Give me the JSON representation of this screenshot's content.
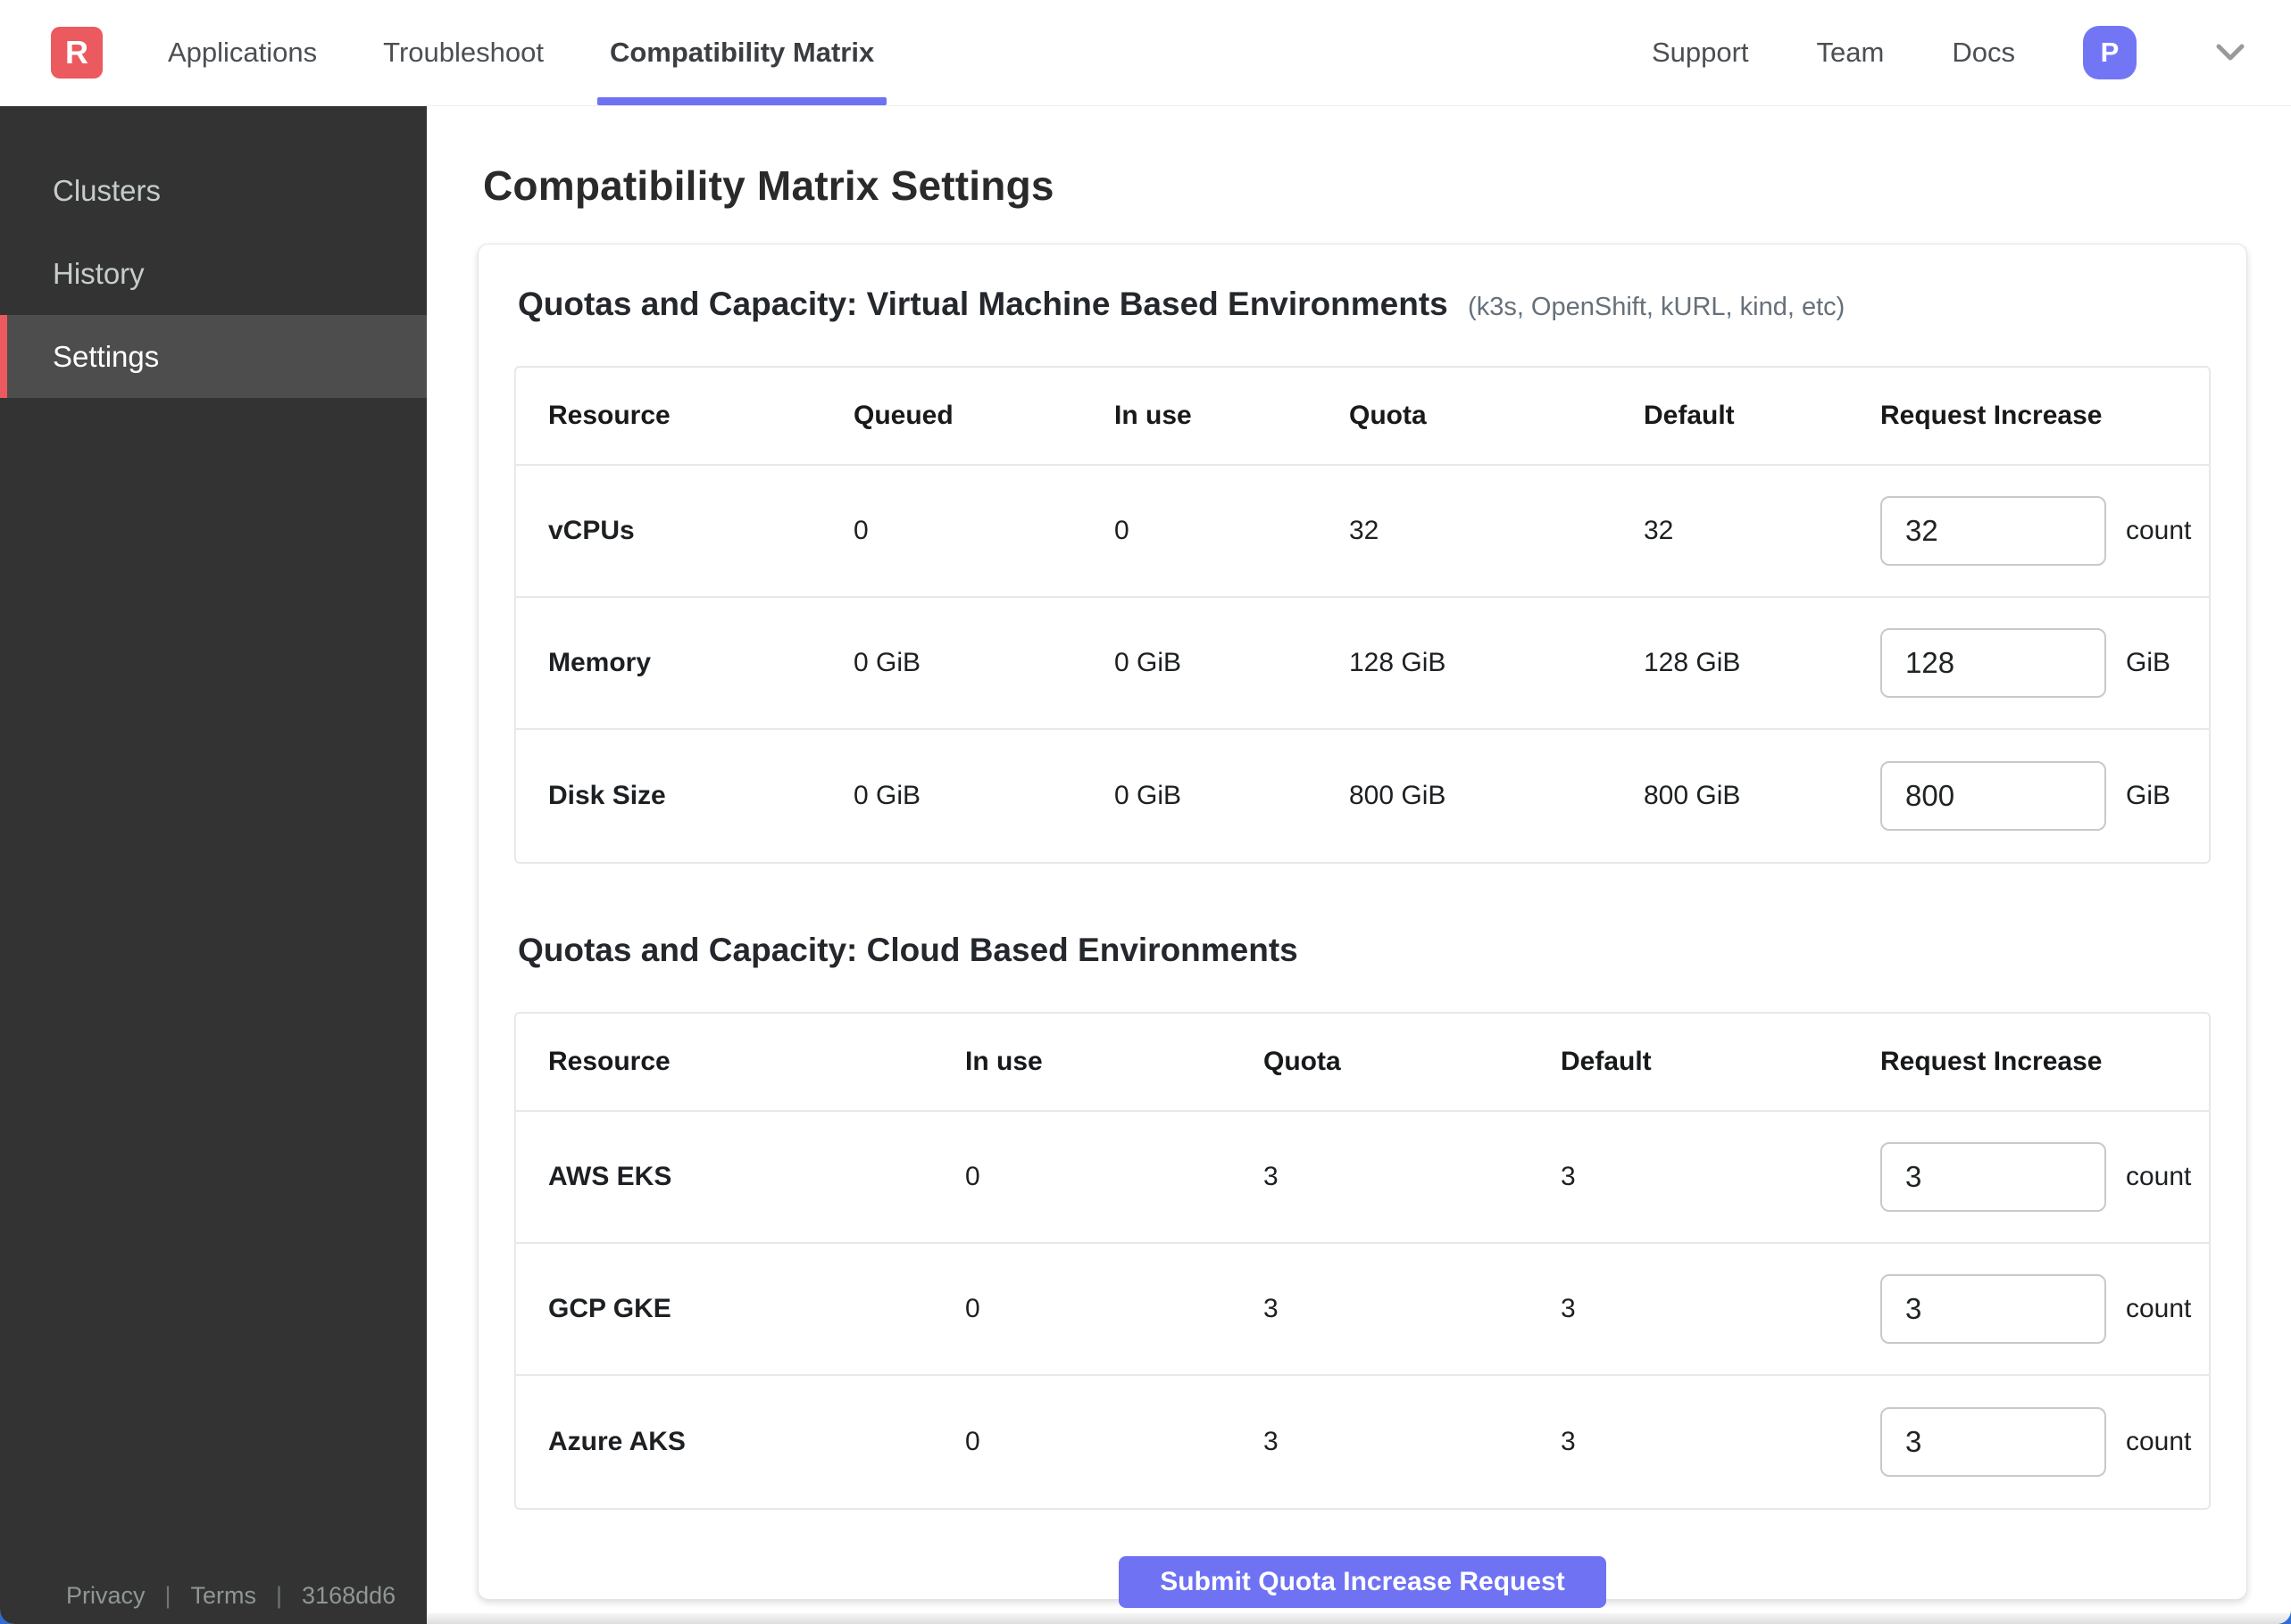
{
  "colors": {
    "brand_red": "#EA5A5F",
    "accent": "#6E72F3",
    "sidebar_bg": "#333333",
    "sidebar_active_bg": "#4D4D4D",
    "table_border": "#E8E8E8"
  },
  "nav": {
    "logo_letter": "R",
    "tabs": [
      {
        "label": "Applications"
      },
      {
        "label": "Troubleshoot"
      },
      {
        "label": "Compatibility Matrix",
        "active": true
      }
    ],
    "right_links": [
      {
        "label": "Support"
      },
      {
        "label": "Team"
      },
      {
        "label": "Docs"
      }
    ],
    "avatar_initial": "P"
  },
  "sidebar": {
    "items": [
      {
        "label": "Clusters"
      },
      {
        "label": "History"
      },
      {
        "label": "Settings",
        "active": true
      }
    ],
    "footer": {
      "privacy": "Privacy",
      "separator": "|",
      "terms": "Terms",
      "build": "3168dd6"
    }
  },
  "page": {
    "title": "Compatibility Matrix Settings",
    "submit_label": "Submit Quota Increase Request",
    "sections": [
      {
        "heading": "Quotas and Capacity: Virtual Machine Based Environments",
        "subheading": "(k3s, OpenShift, kURL, kind, etc)",
        "columns": [
          "Resource",
          "Queued",
          "In use",
          "Quota",
          "Default",
          "Request Increase"
        ],
        "rows": [
          {
            "resource": "vCPUs",
            "queued": "0",
            "in_use": "0",
            "quota": "32",
            "default": "32",
            "request_value": "32",
            "unit": "count"
          },
          {
            "resource": "Memory",
            "queued": "0 GiB",
            "in_use": "0 GiB",
            "quota": "128 GiB",
            "default": "128 GiB",
            "request_value": "128",
            "unit": "GiB"
          },
          {
            "resource": "Disk Size",
            "queued": "0 GiB",
            "in_use": "0 GiB",
            "quota": "800 GiB",
            "default": "800 GiB",
            "request_value": "800",
            "unit": "GiB"
          }
        ]
      },
      {
        "heading": "Quotas and Capacity: Cloud Based Environments",
        "columns": [
          "Resource",
          "In use",
          "Quota",
          "Default",
          "Request Increase"
        ],
        "rows": [
          {
            "resource": "AWS EKS",
            "in_use": "0",
            "quota": "3",
            "default": "3",
            "request_value": "3",
            "unit": "count"
          },
          {
            "resource": "GCP GKE",
            "in_use": "0",
            "quota": "3",
            "default": "3",
            "request_value": "3",
            "unit": "count"
          },
          {
            "resource": "Azure AKS",
            "in_use": "0",
            "quota": "3",
            "default": "3",
            "request_value": "3",
            "unit": "count"
          }
        ]
      }
    ]
  }
}
